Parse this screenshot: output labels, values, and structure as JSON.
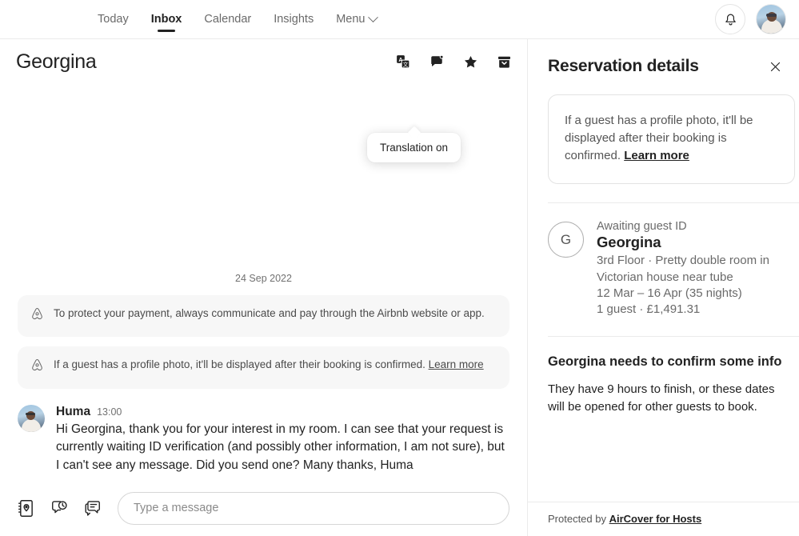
{
  "topnav": {
    "links": [
      {
        "label": "Today",
        "active": false
      },
      {
        "label": "Inbox",
        "active": true
      },
      {
        "label": "Calendar",
        "active": false
      },
      {
        "label": "Insights",
        "active": false
      }
    ],
    "menu_label": "Menu",
    "notifications_icon": "bell-icon",
    "profile_icon": "user-avatar-photo"
  },
  "thread": {
    "title": "Georgina",
    "actions": [
      {
        "name": "translate-icon",
        "label": "Translate"
      },
      {
        "name": "message-bubble-icon",
        "label": "Unread"
      },
      {
        "name": "star-icon",
        "label": "Star"
      },
      {
        "name": "archive-icon",
        "label": "Archive"
      }
    ],
    "tooltip": "Translation on",
    "date_separator": "24 Sep 2022",
    "system_messages": [
      {
        "icon": "airbnb-belo-icon",
        "text": "To protect your payment, always communicate and pay through the Airbnb website or app.",
        "link": ""
      },
      {
        "icon": "airbnb-belo-icon",
        "text": "If a guest has a profile photo, it'll be displayed after their booking is confirmed. ",
        "link": "Learn more"
      }
    ],
    "messages": [
      {
        "sender": "Huma",
        "time": "13:00",
        "text": "Hi Georgina, thank you for your interest in my room. I can see that your request is currently waiting ID verification (and possibly other information, I am not sure), but I can't see any message. Did you send one? Many thanks, Huma"
      }
    ],
    "composer": {
      "icons": [
        {
          "name": "guidebook-icon",
          "label": "Guidebook"
        },
        {
          "name": "scheduled-message-icon",
          "label": "Scheduled messages"
        },
        {
          "name": "quick-replies-icon",
          "label": "Quick replies"
        }
      ],
      "placeholder": "Type a message",
      "value": ""
    }
  },
  "details": {
    "title": "Reservation details",
    "close_icon": "close-icon",
    "note_card": {
      "text": "If a guest has a profile photo, it'll be displayed after their booking is confirmed. ",
      "link": "Learn more"
    },
    "guest": {
      "initial": "G",
      "status": "Awaiting guest ID",
      "name": "Georgina",
      "listing": "3rd Floor · Pretty double room in Victorian house near tube",
      "dates": "12 Mar – 16 Apr (35 nights)",
      "guests_price": "1 guest · £1,491.31"
    },
    "confirm": {
      "title": "Georgina needs to confirm some info",
      "text": "They have 9 hours to finish, or these dates will be opened for other guests to book."
    },
    "footer": {
      "prefix": "Protected by ",
      "link": "AirCover for Hosts"
    }
  },
  "colors": {
    "text_primary": "#222222",
    "text_secondary": "#717171",
    "border": "#ebebeb",
    "surface_muted": "#f7f7f7"
  }
}
